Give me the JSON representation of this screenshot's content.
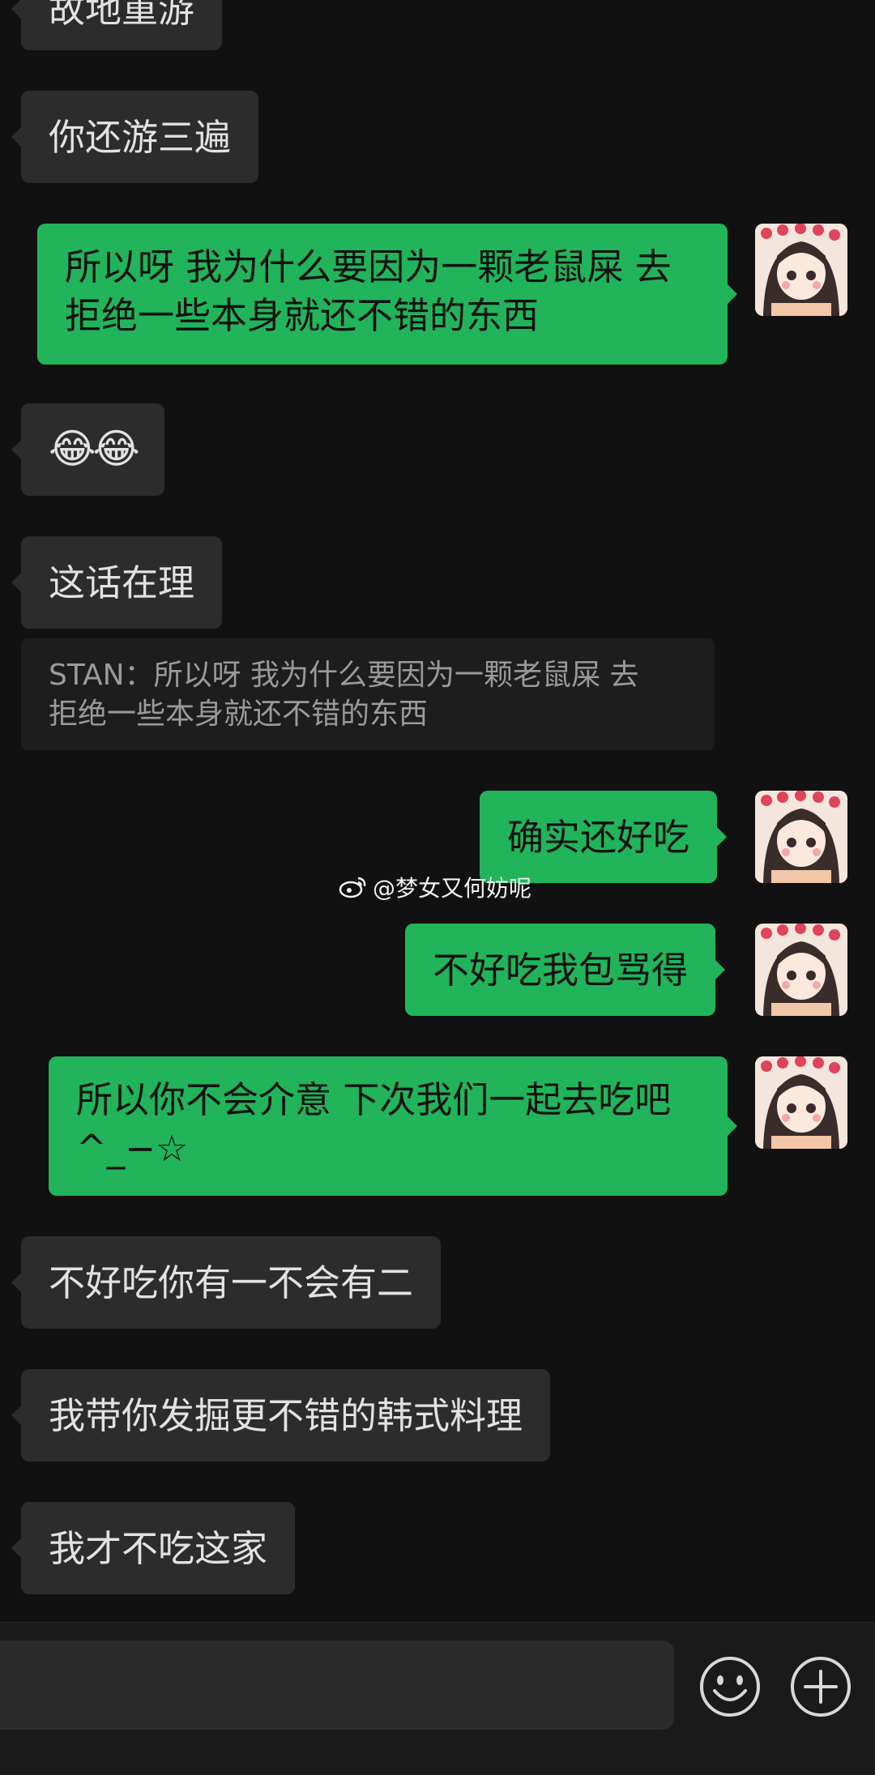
{
  "messages": {
    "m0": "故地重游",
    "m1": "你还游三遍",
    "m2_line1": "所以呀 我为什么要因为一颗老鼠屎 去",
    "m2_line2": "拒绝一些本身就还不错的东西",
    "m3": "😂😂",
    "m4": "这话在理",
    "quote_line1": "STAN：所以呀 我为什么要因为一颗老鼠屎 去",
    "quote_line2": "拒绝一些本身就还不错的东西",
    "m5": "确实还好吃",
    "m6": "不好吃我包骂得",
    "m7_line1": "所以你不会介意 下次我们一起去吃吧",
    "m7_line2": "^_−☆",
    "m8": "不好吃你有一不会有二",
    "m9": "我带你发掘更不错的韩式料理",
    "m10": "我才不吃这家"
  },
  "watermark": "@梦女又何妨呢",
  "icons": {
    "emoji_button": "smiley-icon",
    "plus_button": "plus-circle-icon",
    "weibo": "weibo-logo-icon"
  },
  "colors": {
    "background": "#111111",
    "incoming_bubble": "#2c2c2c",
    "outgoing_bubble": "#21b45a"
  }
}
